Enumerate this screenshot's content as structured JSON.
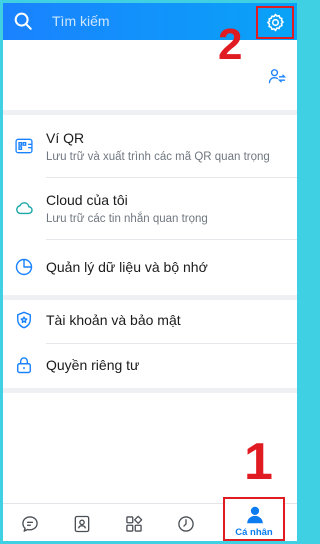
{
  "header": {
    "search_placeholder": "Tìm kiếm",
    "search_icon": "search-icon",
    "settings_icon": "gear-icon"
  },
  "annotations": {
    "step1": "1",
    "step2": "2"
  },
  "profile": {
    "switch_icon": "account-switch-icon"
  },
  "menu": {
    "qr_wallet": {
      "title": "Ví QR",
      "subtitle": "Lưu trữ và xuất trình các mã QR quan trọng",
      "icon": "qr-wallet-icon"
    },
    "cloud": {
      "title": "Cloud của tôi",
      "subtitle": "Lưu trữ các tin nhắn quan trọng",
      "icon": "cloud-icon"
    },
    "storage": {
      "title": "Quản lý dữ liệu và bộ nhớ",
      "icon": "pie-chart-icon"
    },
    "account_security": {
      "title": "Tài khoản và bảo mật",
      "icon": "shield-icon"
    },
    "privacy": {
      "title": "Quyền riêng tư",
      "icon": "lock-icon"
    }
  },
  "bottom_nav": {
    "tabs": [
      {
        "icon": "chat-icon"
      },
      {
        "icon": "contacts-icon"
      },
      {
        "icon": "discover-icon"
      },
      {
        "icon": "timeline-icon"
      },
      {
        "icon": "person-icon",
        "label": "Cá nhân",
        "active": true
      }
    ]
  },
  "colors": {
    "header_start": "#1a82ff",
    "header_end": "#09a3f7",
    "accent": "#0a7cf0",
    "annotation_red": "#e11b22",
    "border_teal": "#3fd0e4"
  }
}
